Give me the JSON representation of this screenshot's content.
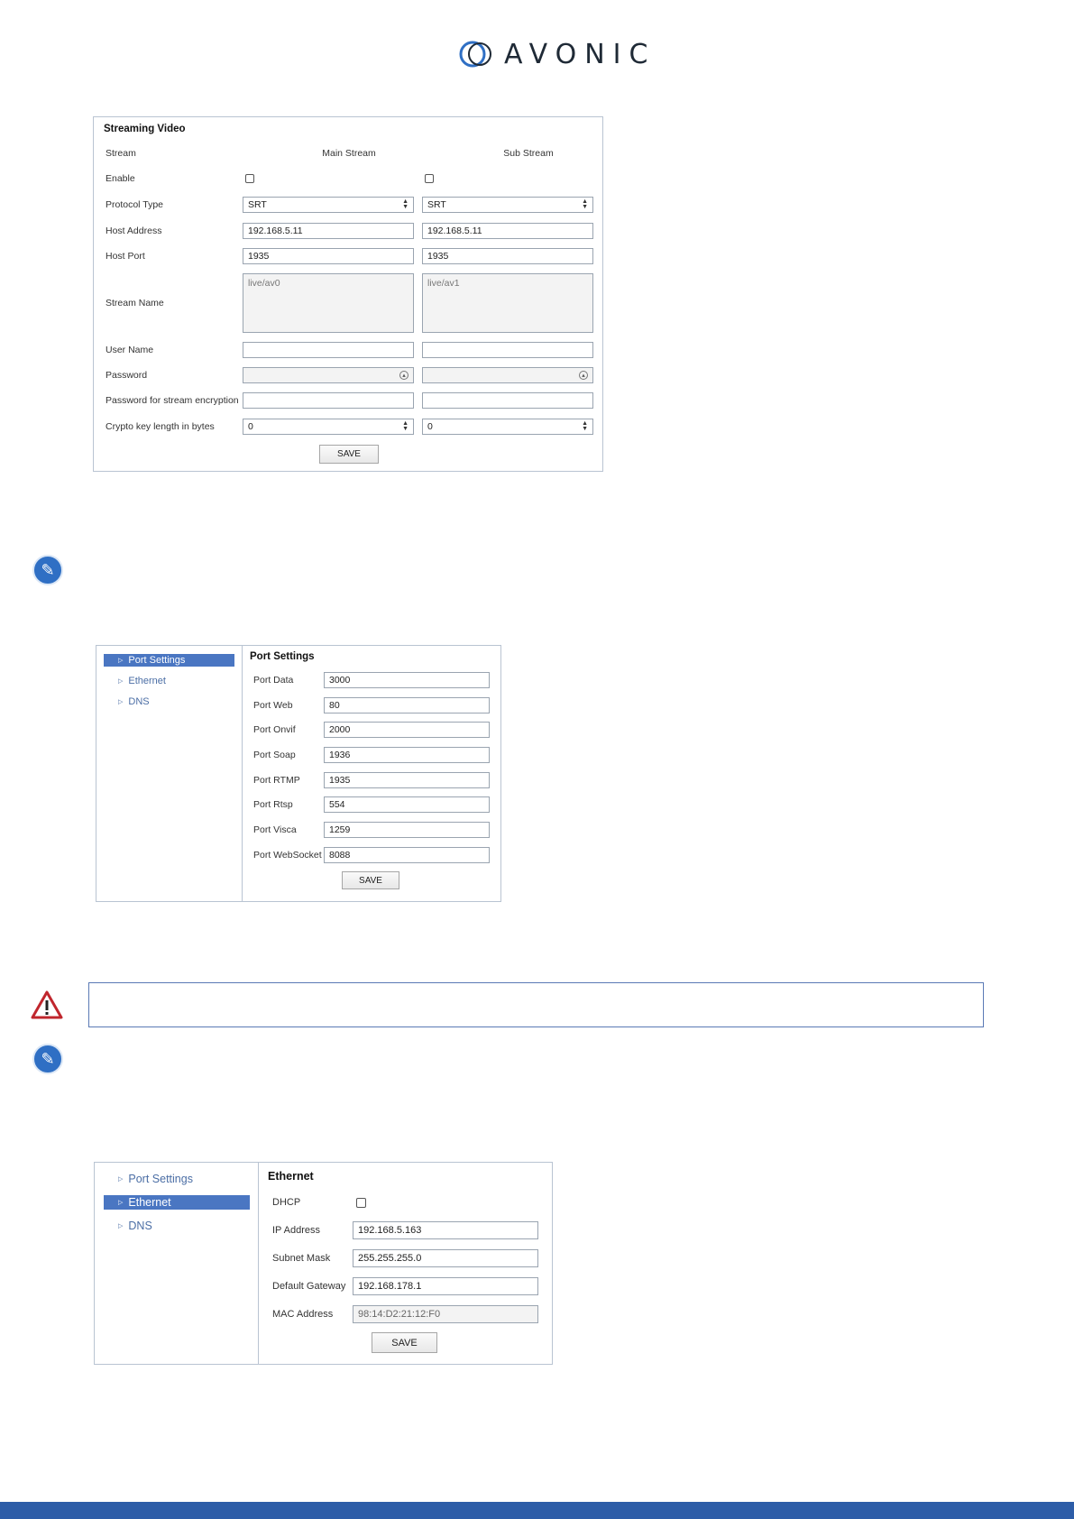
{
  "logo": {
    "text": "AVONIC"
  },
  "streaming": {
    "title": "Streaming Video",
    "col_stream": "Stream",
    "col_main": "Main Stream",
    "col_sub": "Sub Stream",
    "labels": {
      "enable": "Enable",
      "protocol": "Protocol Type",
      "host_address": "Host Address",
      "host_port": "Host Port",
      "stream_name": "Stream Name",
      "user_name": "User Name",
      "password": "Password",
      "enc_password": "Password for stream encryption",
      "crypto": "Crypto key length in bytes"
    },
    "main": {
      "enabled": false,
      "protocol": "SRT",
      "host_address": "192.168.5.11",
      "host_port": "1935",
      "stream_name": "live/av0",
      "user_name": "",
      "password": "",
      "enc_password": "",
      "crypto": "0"
    },
    "sub": {
      "enabled": false,
      "protocol": "SRT",
      "host_address": "192.168.5.11",
      "host_port": "1935",
      "stream_name": "live/av1",
      "user_name": "",
      "password": "",
      "enc_password": "",
      "crypto": "0"
    },
    "save": "SAVE"
  },
  "ports": {
    "nav": [
      "Port Settings",
      "Ethernet",
      "DNS"
    ],
    "title": "Port Settings",
    "rows": [
      {
        "label": "Port Data",
        "value": "3000"
      },
      {
        "label": "Port Web",
        "value": "80"
      },
      {
        "label": "Port Onvif",
        "value": "2000"
      },
      {
        "label": "Port Soap",
        "value": "1936"
      },
      {
        "label": "Port RTMP",
        "value": "1935"
      },
      {
        "label": "Port Rtsp",
        "value": "554"
      },
      {
        "label": "Port Visca",
        "value": "1259"
      },
      {
        "label": "Port WebSocket",
        "value": "8088"
      }
    ],
    "save": "SAVE"
  },
  "ethernet": {
    "nav": [
      "Port Settings",
      "Ethernet",
      "DNS"
    ],
    "title": "Ethernet",
    "dhcp_label": "DHCP",
    "dhcp_checked": false,
    "ip_label": "IP Address",
    "ip": "192.168.5.163",
    "subnet_label": "Subnet Mask",
    "subnet": "255.255.255.0",
    "gateway_label": "Default Gateway",
    "gateway": "192.168.178.1",
    "mac_label": "MAC Address",
    "mac": "98:14:D2:21:12:F0",
    "save": "SAVE"
  },
  "colors": {
    "accent": "#4a76c2",
    "footer": "#2d5da8",
    "note_icon": "#2f6fc4",
    "warn_icon": "#c0262d"
  },
  "icons": {
    "note": "reader-icon",
    "warning": "warning-icon"
  }
}
